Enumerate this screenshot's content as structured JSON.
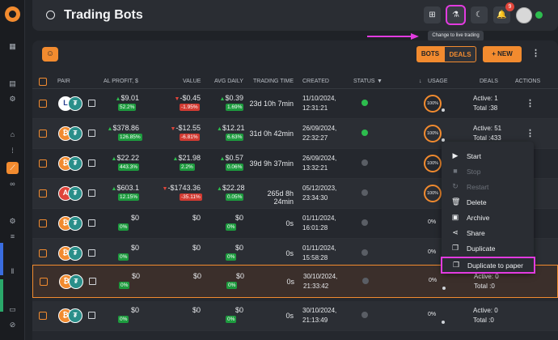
{
  "header": {
    "title": "Trading Bots",
    "tooltip": "Change to live trading",
    "notification_count": "9"
  },
  "toolbar": {
    "bots": "BOTS",
    "deals": "DEALS",
    "new": "+ NEW"
  },
  "columns": [
    "PAIR",
    "AL PROFIT, $",
    "VALUE",
    "AVG DAILY",
    "TRADING TIME",
    "CREATED",
    "STATUS",
    "USAGE",
    "DEALS",
    "ACTIONS"
  ],
  "rows": [
    {
      "profit": "$9.01",
      "profit_pct": "52.2%",
      "profit_dir": "up",
      "value": "-$0.45",
      "value_pct": "-1.95%",
      "value_dir": "dn",
      "avg": "$0.39",
      "avg_pct": "1.69%",
      "avg_dir": "up",
      "time": "23d 10h 7min",
      "created1": "11/10/2024,",
      "created2": "12:31:21",
      "status": "on",
      "usage": "100%",
      "deals1": "Active: 1",
      "deals2": "Total :38",
      "coin": "logo"
    },
    {
      "profit": "$378.86",
      "profit_pct": "126.85%",
      "profit_dir": "up",
      "value": "-$12.55",
      "value_pct": "-6.81%",
      "value_dir": "dn",
      "avg": "$12.21",
      "avg_pct": "6.63%",
      "avg_dir": "up",
      "time": "31d 0h 42min",
      "created1": "26/09/2024,",
      "created2": "22:32:27",
      "status": "on",
      "usage": "100%",
      "deals1": "Active: 51",
      "deals2": "Total :433",
      "coin": "btc"
    },
    {
      "profit": "$22.22",
      "profit_pct": "443.3%",
      "profit_dir": "up",
      "value": "$21.98",
      "value_pct": "2.2%",
      "value_dir": "up",
      "avg": "$0.57",
      "avg_pct": "0.06%",
      "avg_dir": "up",
      "time": "39d 9h 37min",
      "created1": "26/09/2024,",
      "created2": "13:32:21",
      "status": "off",
      "usage": "100%",
      "deals1": "",
      "deals2": "",
      "coin": "btc"
    },
    {
      "profit": "$603.1",
      "profit_pct": "12.15%",
      "profit_dir": "up",
      "value": "-$1743.36",
      "value_pct": "-35.11%",
      "value_dir": "dn",
      "avg": "$22.28",
      "avg_pct": "0.05%",
      "avg_dir": "up",
      "time": "265d 8h 24min",
      "created1": "05/12/2023,",
      "created2": "23:34:30",
      "status": "off",
      "usage": "100%",
      "deals1": "",
      "deals2": "",
      "coin": "avax"
    },
    {
      "profit": "$0",
      "profit_pct": "0%",
      "profit_dir": "none",
      "value": "$0",
      "value_pct": "",
      "value_dir": "none",
      "avg": "$0",
      "avg_pct": "0%",
      "avg_dir": "none",
      "time": "0s",
      "created1": "01/11/2024,",
      "created2": "16:01:28",
      "status": "off",
      "usage": "0%",
      "deals1": "",
      "deals2": "",
      "coin": "btc"
    },
    {
      "profit": "$0",
      "profit_pct": "0%",
      "profit_dir": "none",
      "value": "$0",
      "value_pct": "",
      "value_dir": "none",
      "avg": "$0",
      "avg_pct": "0%",
      "avg_dir": "none",
      "time": "0s",
      "created1": "01/11/2024,",
      "created2": "15:58:28",
      "status": "off",
      "usage": "0%",
      "deals1": "",
      "deals2": "",
      "coin": "btc"
    },
    {
      "profit": "$0",
      "profit_pct": "0%",
      "profit_dir": "none",
      "value": "$0",
      "value_pct": "",
      "value_dir": "none",
      "avg": "$0",
      "avg_pct": "0%",
      "avg_dir": "none",
      "time": "0s",
      "created1": "30/10/2024,",
      "created2": "21:33:42",
      "status": "off",
      "usage": "0%",
      "deals1": "Active: 0",
      "deals2": "Total :0",
      "coin": "btc"
    },
    {
      "profit": "$0",
      "profit_pct": "0%",
      "profit_dir": "none",
      "value": "$0",
      "value_pct": "",
      "value_dir": "none",
      "avg": "$0",
      "avg_pct": "0%",
      "avg_dir": "none",
      "time": "0s",
      "created1": "30/10/2024,",
      "created2": "21:13:49",
      "status": "off",
      "usage": "0%",
      "deals1": "Active: 0",
      "deals2": "Total :0",
      "coin": "btc"
    }
  ],
  "menu": [
    {
      "label": "Start",
      "icon": "play-icon",
      "glyph": "▶",
      "disabled": false
    },
    {
      "label": "Stop",
      "icon": "stop-icon",
      "glyph": "■",
      "disabled": true
    },
    {
      "label": "Restart",
      "icon": "restart-icon",
      "glyph": "↻",
      "disabled": true
    },
    {
      "label": "Delete",
      "icon": "trash-icon",
      "glyph": "🗑",
      "disabled": false
    },
    {
      "label": "Archive",
      "icon": "archive-icon",
      "glyph": "▣",
      "disabled": false
    },
    {
      "label": "Share",
      "icon": "share-icon",
      "glyph": "⋖",
      "disabled": false
    },
    {
      "label": "Duplicate",
      "icon": "duplicate-icon",
      "glyph": "❐",
      "disabled": false
    },
    {
      "label": "Duplicate to paper",
      "icon": "duplicate-paper-icon",
      "glyph": "❐",
      "disabled": false
    }
  ],
  "colors": {
    "accent": "#f28b2f",
    "up": "#2dbd4e",
    "down": "#e0453a",
    "highlight": "#e23be0"
  }
}
